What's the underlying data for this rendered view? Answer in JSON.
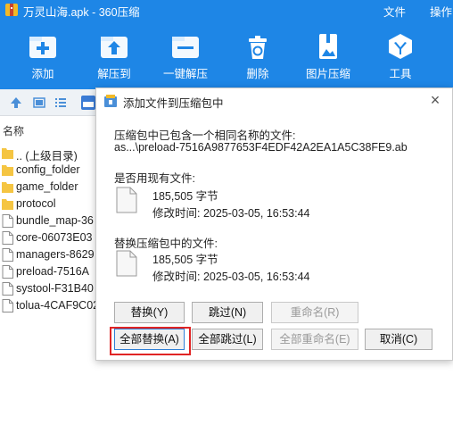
{
  "window": {
    "title": "万灵山海.apk - 360压缩",
    "menu": [
      "文件",
      "操作"
    ]
  },
  "toolbar": {
    "items": [
      {
        "label": "添加",
        "icon": "add-icon"
      },
      {
        "label": "解压到",
        "icon": "extract-to-icon"
      },
      {
        "label": "一键解压",
        "icon": "one-click-extract-icon"
      },
      {
        "label": "删除",
        "icon": "recycle-icon"
      },
      {
        "label": "图片压缩",
        "icon": "image-compress-icon"
      },
      {
        "label": "工具",
        "icon": "tools-icon"
      }
    ]
  },
  "filelist": {
    "header": "名称",
    "rows": [
      {
        "name": ".. (上级目录)",
        "type": "folder"
      },
      {
        "name": "config_folder",
        "type": "folder"
      },
      {
        "name": "game_folder",
        "type": "folder"
      },
      {
        "name": "protocol",
        "type": "folder"
      },
      {
        "name": "bundle_map-36",
        "type": "file"
      },
      {
        "name": "core-06073E03",
        "type": "file"
      },
      {
        "name": "managers-8629",
        "type": "file"
      },
      {
        "name": "preload-7516A",
        "type": "file"
      },
      {
        "name": "systool-F31B40",
        "type": "file"
      },
      {
        "name": "tolua-4CAF9C02",
        "type": "file"
      }
    ]
  },
  "dialog": {
    "title": "添加文件到压缩包中",
    "line1": "压缩包中已包含一个相同名称的文件:",
    "line2": "as...\\preload-7516A9877653F4EDF42A2EA1A5C38FE9.ab",
    "existing_label": "是否用现有文件:",
    "existing_size": "185,505 字节",
    "existing_time": "修改时间: 2025-03-05, 16:53:44",
    "replace_label": "替换压缩包中的文件:",
    "replace_size": "185,505 字节",
    "replace_time": "修改时间: 2025-03-05, 16:53:44",
    "buttons": {
      "replace": "替换(Y)",
      "skip": "跳过(N)",
      "rename": "重命名(R)",
      "replace_all": "全部替换(A)",
      "skip_all": "全部跳过(L)",
      "rename_all": "全部重命名(E)",
      "cancel": "取消(C)"
    }
  },
  "colors": {
    "toolbar_bg": "#1e86e6",
    "highlight": "#e02424",
    "folder": "#f5c542"
  }
}
